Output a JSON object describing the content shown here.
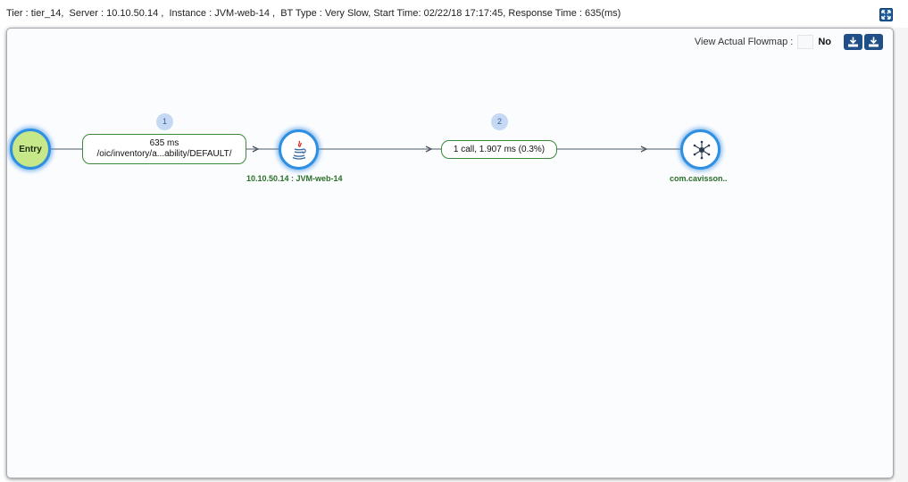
{
  "title_bar": {
    "tier": "Tier : tier_14,",
    "server": "Server : 10.10.50.14 ,",
    "instance": "Instance : JVM-web-14 ,",
    "bt_type": "BT Type : Very Slow,",
    "start_time": "Start Time: 02/22/18 17:17:45,",
    "response_time": "Response Time : 635(ms)"
  },
  "toolbar": {
    "view_actual_flowmap_label": "View Actual Flowmap :",
    "view_actual_flowmap_value": "No"
  },
  "flowmap": {
    "entry_node": {
      "label": "Entry"
    },
    "edges": [
      {
        "badge": "1",
        "line1": "635 ms",
        "line2": "/oic/inventory/a...ability/DEFAULT/"
      },
      {
        "badge": "2",
        "line1": "1 call, 1.907 ms (0.3%)"
      }
    ],
    "jvm_node": {
      "caption": "10.10.50.14 : JVM-web-14",
      "icon": "java-icon"
    },
    "ext_node": {
      "caption": "com.cavisson..",
      "icon": "network-hub-icon"
    }
  },
  "colors": {
    "accent": "#2f8fe0",
    "entry_fill": "#c6e888",
    "caption_green": "#2a6f2a",
    "button_blue": "#1f4f86"
  }
}
